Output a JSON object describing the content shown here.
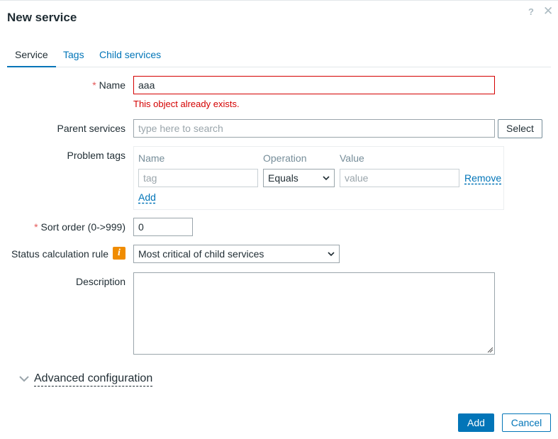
{
  "dialog": {
    "title": "New service",
    "help_icon": "?",
    "close_icon": "✕"
  },
  "tabs": [
    {
      "label": "Service",
      "active": true
    },
    {
      "label": "Tags",
      "active": false
    },
    {
      "label": "Child services",
      "active": false
    }
  ],
  "form": {
    "required_mark": "*",
    "name": {
      "label": "Name",
      "value": "aaa",
      "error": "This object already exists."
    },
    "parent_services": {
      "label": "Parent services",
      "placeholder": "type here to search",
      "select_button": "Select"
    },
    "problem_tags": {
      "label": "Problem tags",
      "columns": [
        "Name",
        "Operation",
        "Value"
      ],
      "row": {
        "tag_placeholder": "tag",
        "operation": "Equals",
        "value_placeholder": "value",
        "remove_label": "Remove"
      },
      "add_label": "Add"
    },
    "sort_order": {
      "label": "Sort order (0->999)",
      "value": "0"
    },
    "status_rule": {
      "label": "Status calculation rule",
      "info_icon": "i",
      "value": "Most critical of child services"
    },
    "description": {
      "label": "Description",
      "value": ""
    },
    "advanced": {
      "label": "Advanced configuration"
    }
  },
  "footer": {
    "add_button": "Add",
    "cancel_button": "Cancel"
  },
  "colors": {
    "accent": "#0275b8",
    "error": "#d40000",
    "required": "#e45959",
    "info": "#f08c00"
  }
}
